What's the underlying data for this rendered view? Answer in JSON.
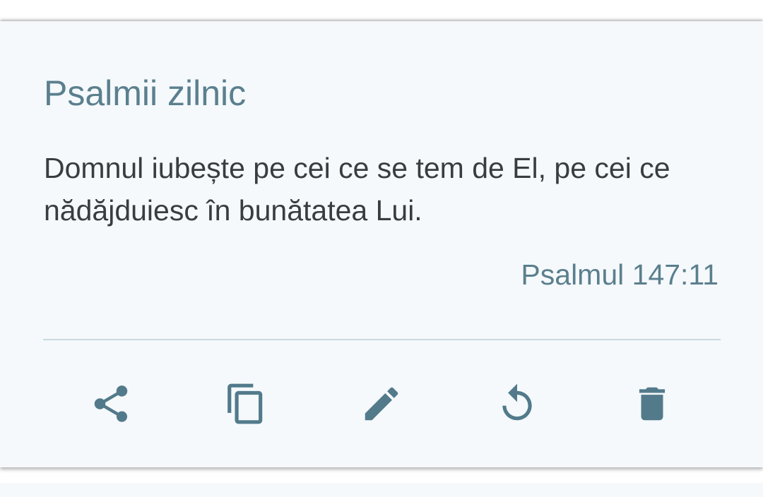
{
  "card": {
    "title": "Psalmii zilnic",
    "verse": "Domnul iubește pe cei ce se tem de El, pe cei ce nădăjduiesc în bunătatea Lui.",
    "reference": "Psalmul 147:11"
  },
  "actions": [
    {
      "name": "share",
      "icon": "share-icon"
    },
    {
      "name": "copy",
      "icon": "copy-icon"
    },
    {
      "name": "edit",
      "icon": "pencil-icon"
    },
    {
      "name": "reset",
      "icon": "refresh-icon"
    },
    {
      "name": "delete",
      "icon": "trash-icon"
    }
  ],
  "colors": {
    "accent": "#5b7f8e",
    "icon": "#527a8b",
    "text": "#3a3d40",
    "card_bg": "#f5f9fb",
    "divider": "#c9d9e0"
  }
}
